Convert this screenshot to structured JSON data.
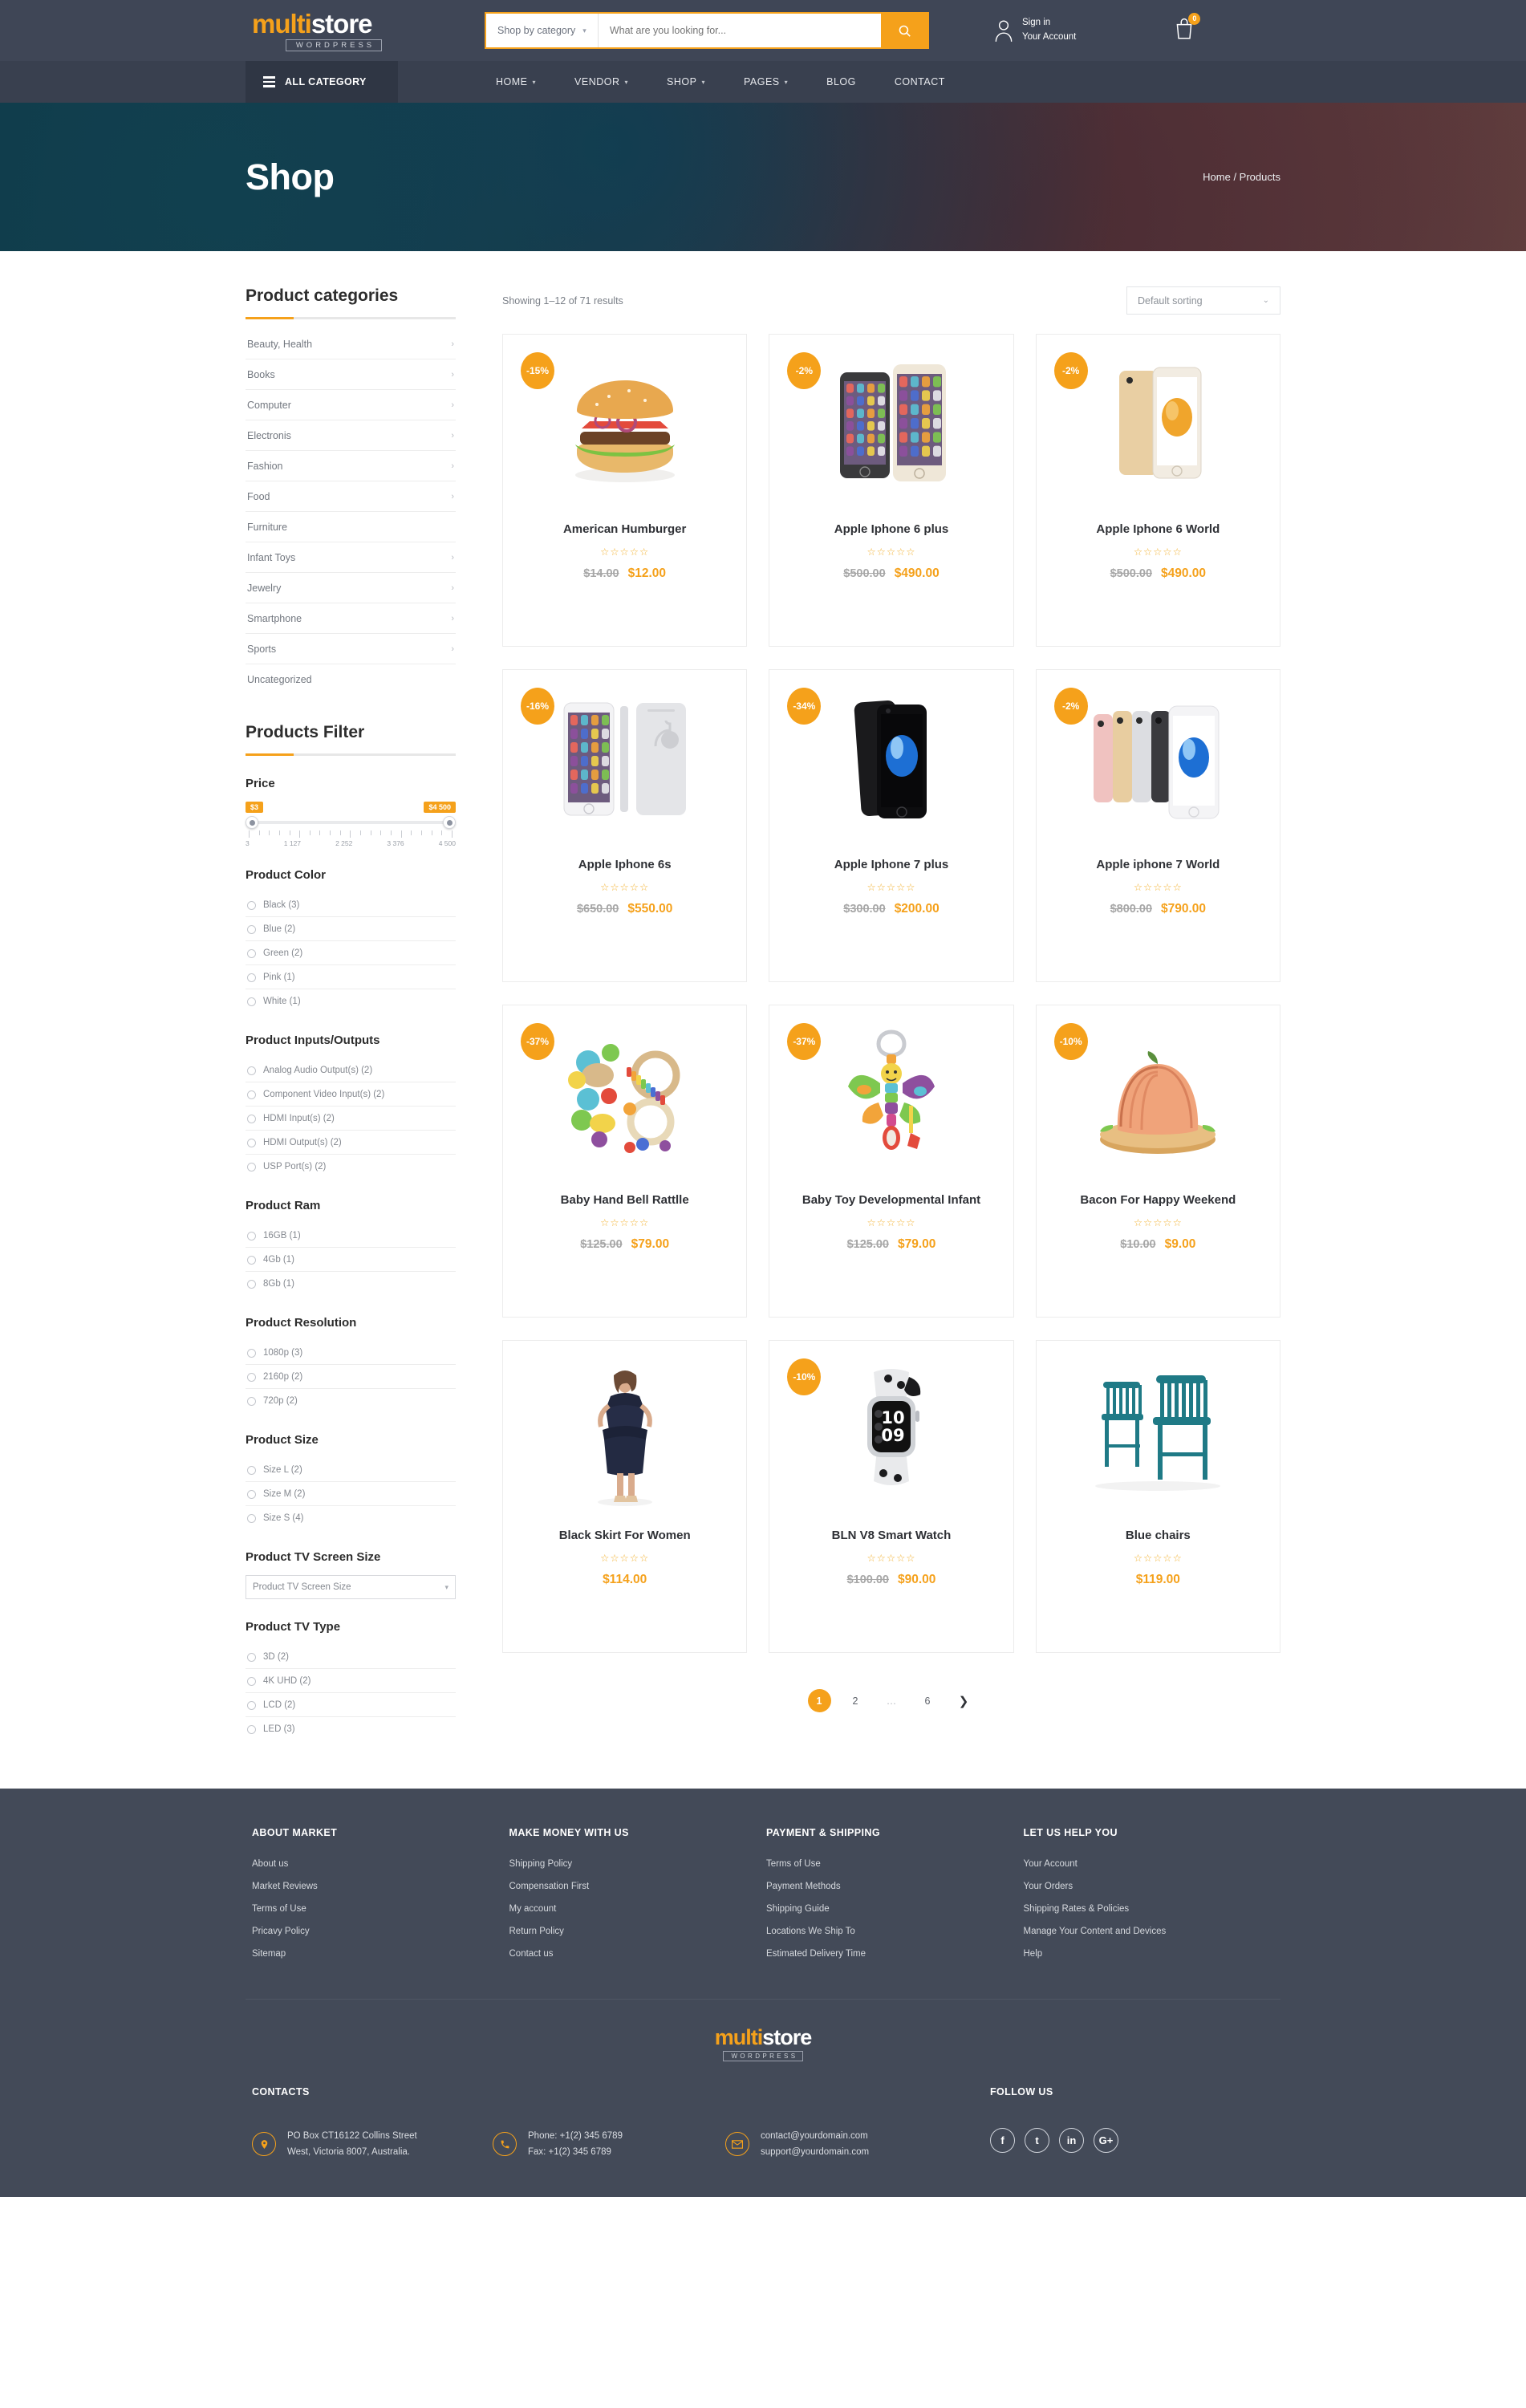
{
  "header": {
    "logo": {
      "part1": "multi",
      "part2": "store",
      "sub": "WORDPRESS"
    },
    "search": {
      "category_label": "Shop by category",
      "placeholder": "What are you looking for...",
      "value": ""
    },
    "account": {
      "line1": "Sign in",
      "line2": "Your Account"
    },
    "cart": {
      "count": "0"
    },
    "all_category": "ALL CATEGORY",
    "nav": [
      {
        "label": "HOME",
        "has_dropdown": true
      },
      {
        "label": "VENDOR",
        "has_dropdown": true
      },
      {
        "label": "SHOP",
        "has_dropdown": true
      },
      {
        "label": "PAGES",
        "has_dropdown": true
      },
      {
        "label": "BLOG",
        "has_dropdown": false
      },
      {
        "label": "CONTACT",
        "has_dropdown": false
      }
    ]
  },
  "hero": {
    "title": "Shop",
    "breadcrumb": "Home / Products"
  },
  "sidebar": {
    "categories_title": "Product categories",
    "categories": [
      {
        "label": "Beauty, Health",
        "has_children": true
      },
      {
        "label": "Books",
        "has_children": true
      },
      {
        "label": "Computer",
        "has_children": true
      },
      {
        "label": "Electronis",
        "has_children": true
      },
      {
        "label": "Fashion",
        "has_children": true
      },
      {
        "label": "Food",
        "has_children": true
      },
      {
        "label": "Furniture",
        "has_children": false
      },
      {
        "label": "Infant Toys",
        "has_children": true
      },
      {
        "label": "Jewelry",
        "has_children": true
      },
      {
        "label": "Smartphone",
        "has_children": true
      },
      {
        "label": "Sports",
        "has_children": true
      },
      {
        "label": "Uncategorized",
        "has_children": false
      }
    ],
    "filter_title": "Products Filter",
    "price": {
      "heading": "Price",
      "min_bubble": "$3",
      "max_bubble": "$4 500",
      "tick_labels": [
        "3",
        "1 127",
        "2 252",
        "3 376",
        "4 500"
      ],
      "min": 3,
      "max": 4500
    },
    "groups": [
      {
        "heading": "Product Color",
        "options": [
          "Black (3)",
          "Blue (2)",
          "Green (2)",
          "Pink (1)",
          "White (1)"
        ]
      },
      {
        "heading": "Product Inputs/Outputs",
        "options": [
          "Analog Audio Output(s) (2)",
          "Component Video Input(s) (2)",
          "HDMI Input(s) (2)",
          "HDMI Output(s) (2)",
          "USP Port(s) (2)"
        ]
      },
      {
        "heading": "Product Ram",
        "options": [
          "16GB (1)",
          "4Gb (1)",
          "8Gb (1)"
        ]
      },
      {
        "heading": "Product Resolution",
        "options": [
          "1080p (3)",
          "2160p (2)",
          "720p (2)"
        ]
      },
      {
        "heading": "Product Size",
        "options": [
          "Size L (2)",
          "Size M (2)",
          "Size S (4)"
        ]
      }
    ],
    "tv_screen": {
      "heading": "Product TV Screen Size",
      "selected": "Product TV Screen Size"
    },
    "tv_type": {
      "heading": "Product TV Type",
      "options": [
        "3D (2)",
        "4K UHD (2)",
        "LCD (2)",
        "LED (3)"
      ]
    }
  },
  "main": {
    "result_count": "Showing 1–12 of 71 results",
    "sorting": "Default sorting",
    "products": [
      {
        "name": "American Humburger",
        "badge": "-15%",
        "old_price": "$14.00",
        "new_price": "$12.00",
        "rating": 0,
        "image": "hamburger"
      },
      {
        "name": "Apple Iphone 6 plus",
        "badge": "-2%",
        "old_price": "$500.00",
        "new_price": "$490.00",
        "rating": 0,
        "image": "iphone6plus"
      },
      {
        "name": "Apple Iphone 6 World",
        "badge": "-2%",
        "old_price": "$500.00",
        "new_price": "$490.00",
        "rating": 0,
        "image": "iphone6world"
      },
      {
        "name": "Apple Iphone 6s",
        "badge": "-16%",
        "old_price": "$650.00",
        "new_price": "$550.00",
        "rating": 0,
        "image": "iphone6s"
      },
      {
        "name": "Apple Iphone 7 plus",
        "badge": "-34%",
        "old_price": "$300.00",
        "new_price": "$200.00",
        "rating": 0,
        "image": "iphone7plus"
      },
      {
        "name": "Apple iphone 7 World",
        "badge": "-2%",
        "old_price": "$800.00",
        "new_price": "$790.00",
        "rating": 0,
        "image": "iphone7world"
      },
      {
        "name": "Baby Hand Bell Rattlle",
        "badge": "-37%",
        "old_price": "$125.00",
        "new_price": "$79.00",
        "rating": 0,
        "image": "rattle"
      },
      {
        "name": "Baby Toy Developmental Infant",
        "badge": "-37%",
        "old_price": "$125.00",
        "new_price": "$79.00",
        "rating": 0,
        "image": "babytoy"
      },
      {
        "name": "Bacon For Happy Weekend",
        "badge": "-10%",
        "old_price": "$10.00",
        "new_price": "$9.00",
        "rating": 0,
        "image": "bacon"
      },
      {
        "name": "Black Skirt For Women",
        "badge": "",
        "old_price": "",
        "new_price": "$114.00",
        "rating": 0,
        "image": "skirt"
      },
      {
        "name": "BLN V8 Smart Watch",
        "badge": "-10%",
        "old_price": "$100.00",
        "new_price": "$90.00",
        "rating": 0,
        "image": "watch"
      },
      {
        "name": "Blue chairs",
        "badge": "",
        "old_price": "",
        "new_price": "$119.00",
        "rating": 0,
        "image": "chairs"
      }
    ],
    "pagination": {
      "pages": [
        "1",
        "2",
        "…",
        "6"
      ],
      "active": "1",
      "next_icon": "chevron-right"
    }
  },
  "footer": {
    "columns": [
      {
        "title": "ABOUT MARKET",
        "links": [
          "About us",
          "Market Reviews",
          "Terms of Use",
          "Pricavy Policy",
          "Sitemap"
        ]
      },
      {
        "title": "MAKE MONEY WITH US",
        "links": [
          "Shipping Policy",
          "Compensation First",
          "My account",
          "Return Policy",
          "Contact us"
        ]
      },
      {
        "title": "PAYMENT & SHIPPING",
        "links": [
          "Terms of Use",
          "Payment Methods",
          "Shipping Guide",
          "Locations We Ship To",
          "Estimated Delivery Time"
        ]
      },
      {
        "title": "LET US HELP YOU",
        "links": [
          "Your Account",
          "Your Orders",
          "Shipping Rates & Policies",
          "Manage Your Content and Devices",
          "Help"
        ]
      }
    ],
    "logo": {
      "part1": "multi",
      "part2": "store",
      "sub": "WORDPRESS"
    },
    "contacts_heading": "CONTACTS",
    "address_line1": "PO Box CT16122 Collins Street",
    "address_line2": "West, Victoria 8007, Australia.",
    "phone_line1": "Phone: +1(2) 345 6789",
    "phone_line2": "Fax: +1(2) 345 6789",
    "email_line1": "contact@yourdomain.com",
    "email_line2": "support@yourdomain.com",
    "follow_heading": "FOLLOW US",
    "socials": [
      "f",
      "t",
      "in",
      "G+"
    ]
  },
  "colors": {
    "accent": "#f5a11b",
    "header_bg": "#3f4656",
    "nav_bg": "#39404f",
    "footer_bg": "#434a58"
  }
}
